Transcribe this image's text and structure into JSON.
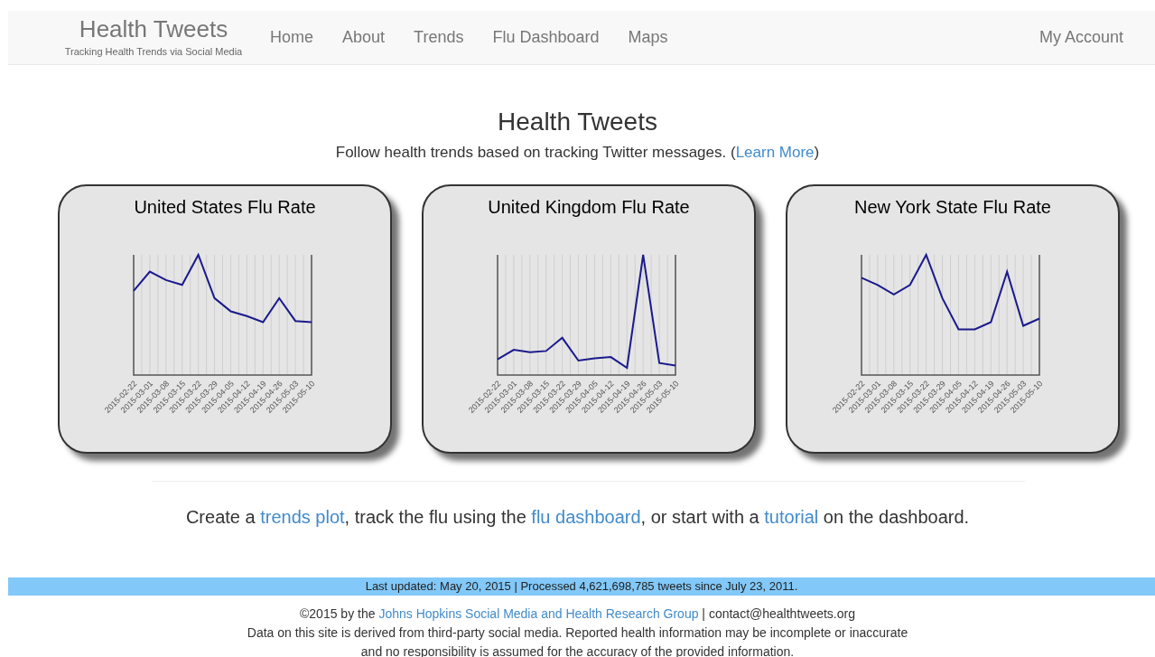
{
  "navbar": {
    "brand": "Health Tweets",
    "tagline": "Tracking Health Trends via Social Media",
    "links": [
      {
        "label": "Home"
      },
      {
        "label": "About"
      },
      {
        "label": "Trends"
      },
      {
        "label": "Flu Dashboard"
      },
      {
        "label": "Maps"
      }
    ],
    "account": "My Account"
  },
  "heading": "Health Tweets",
  "subheading": [
    {
      "kind": "text",
      "text": "Follow health trends based on tracking Twitter messages. ("
    },
    {
      "kind": "link",
      "text": "Learn More"
    },
    {
      "kind": "text",
      "text": ")"
    }
  ],
  "cards": [
    {
      "title": "United States Flu Rate",
      "x_labels": [
        "2015-02-22",
        "2015-03-01",
        "2015-03-08",
        "2015-03-15",
        "2015-03-22",
        "2015-03-29",
        "2015-04-05",
        "2015-04-12",
        "2015-04-19",
        "2015-04-26",
        "2015-05-03",
        "2015-05-10"
      ]
    },
    {
      "title": "United Kingdom Flu Rate",
      "x_labels": [
        "2015-02-22",
        "2015-03-01",
        "2015-03-08",
        "2015-03-15",
        "2015-03-22",
        "2015-03-29",
        "2015-04-05",
        "2015-04-12",
        "2015-04-19",
        "2015-04-26",
        "2015-05-03",
        "2015-05-10"
      ]
    },
    {
      "title": "New York State Flu Rate",
      "x_labels": [
        "2015-02-22",
        "2015-03-01",
        "2015-03-08",
        "2015-03-15",
        "2015-03-22",
        "2015-03-29",
        "2015-04-05",
        "2015-04-12",
        "2015-04-19",
        "2015-04-26",
        "2015-05-03",
        "2015-05-10"
      ]
    }
  ],
  "call_to_action": [
    {
      "kind": "text",
      "text": "Create a "
    },
    {
      "kind": "link",
      "text": "trends plot"
    },
    {
      "kind": "text",
      "text": ", track the flu using the "
    },
    {
      "kind": "link",
      "text": "flu dashboard"
    },
    {
      "kind": "text",
      "text": ", or start with a "
    },
    {
      "kind": "link",
      "text": "tutorial"
    },
    {
      "kind": "text",
      "text": " on the dashboard."
    }
  ],
  "status_bar": "Last updated: May 20, 2015 | Processed 4,621,698,785 tweets since July 23, 2011.",
  "footer": {
    "credit": [
      {
        "kind": "text",
        "text": "©2015 by the "
      },
      {
        "kind": "link",
        "text": "Johns Hopkins Social Media and Health Research Group"
      },
      {
        "kind": "text",
        "text": " | contact@healthtweets.org"
      }
    ],
    "disclaimer": [
      "Data on this site is derived from third-party social media. Reported health information may be incomplete or inaccurate",
      "and no responsibility is assumed for the accuracy of the provided information."
    ]
  }
}
